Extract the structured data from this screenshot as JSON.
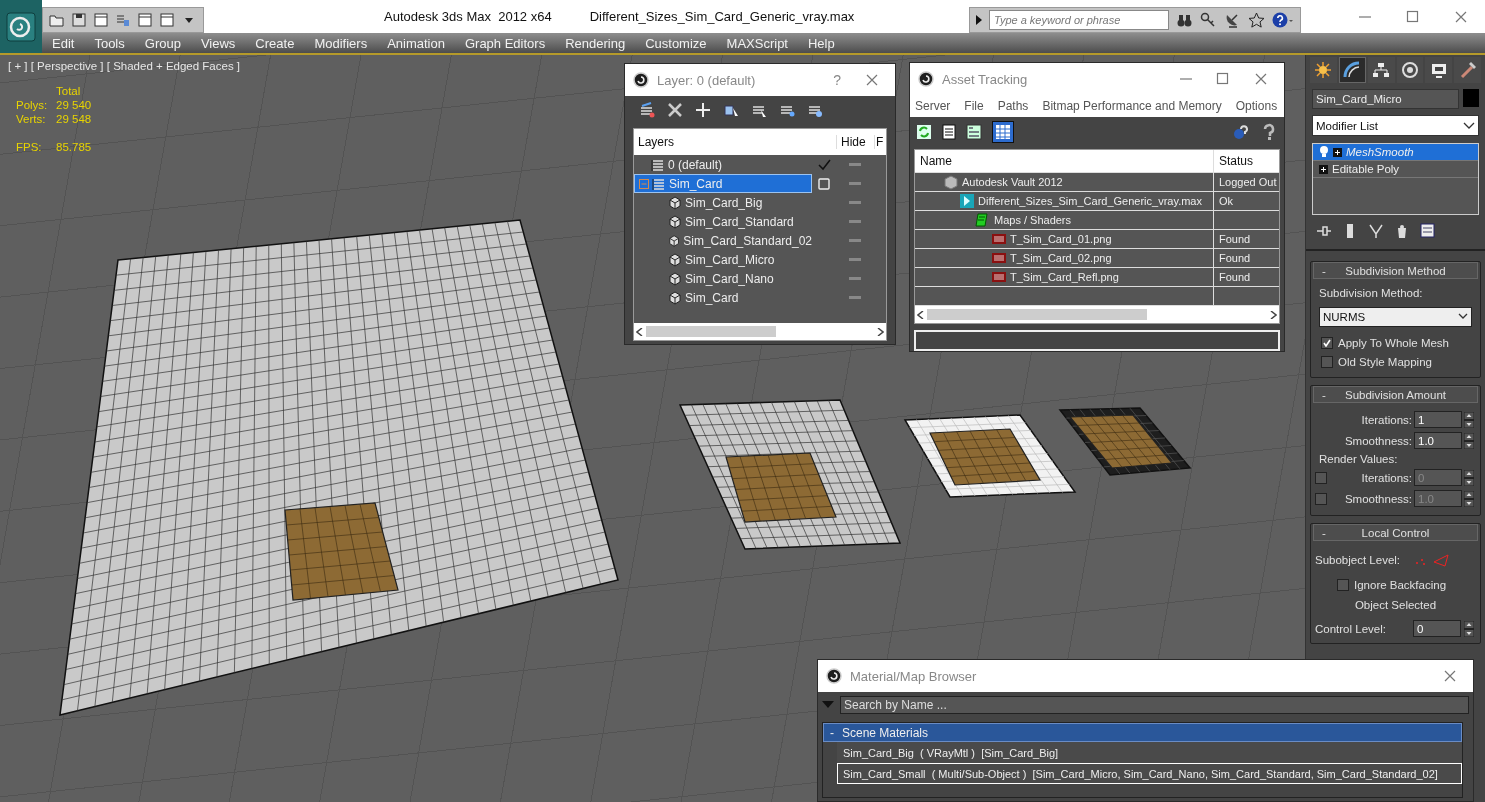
{
  "window": {
    "title": "Autodesk 3ds Max  2012 x64",
    "document": "Different_Sizes_Sim_Card_Generic_vray.max"
  },
  "search": {
    "placeholder": "Type a keyword or phrase"
  },
  "menu": [
    "Edit",
    "Tools",
    "Group",
    "Views",
    "Create",
    "Modifiers",
    "Animation",
    "Graph Editors",
    "Rendering",
    "Customize",
    "MAXScript",
    "Help"
  ],
  "viewport": {
    "label": "[ + ] [ Perspective ] [ Shaded + Edged Faces ]",
    "stats_header": "Total",
    "stats": [
      {
        "label": "Polys:",
        "value": "29 540"
      },
      {
        "label": "Verts:",
        "value": "29 548"
      }
    ],
    "fps_label": "FPS:",
    "fps": "85.785"
  },
  "layer_dialog": {
    "title": "Layer: 0 (default)",
    "help": "?",
    "columns": [
      "Layers",
      "Hide",
      "F"
    ],
    "layers": [
      {
        "name": "0 (default)",
        "current": true,
        "selected": false
      },
      {
        "name": "Sim_Card",
        "current": false,
        "selected": true,
        "expanded": true,
        "children": [
          {
            "name": "Sim_Card_Big"
          },
          {
            "name": "Sim_Card_Standard"
          },
          {
            "name": "Sim_Card_Standard_02"
          },
          {
            "name": "Sim_Card_Micro"
          },
          {
            "name": "Sim_Card_Nano"
          },
          {
            "name": "Sim_Card"
          }
        ]
      }
    ]
  },
  "asset_tracking": {
    "title": "Asset Tracking",
    "menu": [
      "Server",
      "File",
      "Paths",
      "Bitmap Performance and Memory",
      "Options"
    ],
    "columns": [
      "Name",
      "Status"
    ],
    "rows": [
      {
        "kind": "vault",
        "name": "Autodesk Vault 2012",
        "status": "Logged Out",
        "children": [
          {
            "kind": "scene",
            "name": "Different_Sizes_Sim_Card_Generic_vray.max",
            "status": "Ok",
            "children": [
              {
                "kind": "folder",
                "name": "Maps / Shaders",
                "children": [
                  {
                    "kind": "image",
                    "name": "T_Sim_Card_01.png",
                    "status": "Found"
                  },
                  {
                    "kind": "image",
                    "name": "T_Sim_Card_02.png",
                    "status": "Found"
                  },
                  {
                    "kind": "image",
                    "name": "T_Sim_Card_Refl.png",
                    "status": "Found"
                  }
                ]
              }
            ]
          }
        ]
      }
    ]
  },
  "command_panel": {
    "tabs": [
      {
        "kind": "create",
        "selected": false
      },
      {
        "kind": "modify",
        "selected": true
      },
      {
        "kind": "hierarchy",
        "selected": false
      },
      {
        "kind": "motion",
        "selected": false
      },
      {
        "kind": "display",
        "selected": false
      },
      {
        "kind": "utilities",
        "selected": false
      }
    ],
    "object_name": "Sim_Card_Micro",
    "modifier_list": "Modifier List",
    "stack": [
      {
        "kind": "modifier",
        "name": "MeshSmooth",
        "selected": true
      },
      {
        "kind": "base",
        "name": "Editable Poly",
        "selected": false
      }
    ],
    "subdivision_method": {
      "toggle": "-",
      "title": "Subdivision Method",
      "label": "Subdivision Method:",
      "method": "NURMS",
      "options": [
        {
          "label": "Apply To Whole Mesh",
          "checked": true
        },
        {
          "label": "Old Style Mapping",
          "checked": false
        }
      ]
    },
    "subdivision_amount": {
      "toggle": "-",
      "title": "Subdivision Amount",
      "spinners": [
        {
          "label": "Iterations:",
          "value": "1"
        },
        {
          "label": "Smoothness:",
          "value": "1.0"
        }
      ],
      "render_label": "Render Values:",
      "render_spinners": [
        {
          "label": "Iterations:",
          "value": "0",
          "checked": false
        },
        {
          "label": "Smoothness:",
          "value": "1.0",
          "checked": false
        }
      ]
    },
    "local_control": {
      "toggle": "-",
      "title": "Local Control",
      "subobject_label": "Subobject Level:",
      "ignore_backfacing": {
        "label": "Ignore Backfacing",
        "checked": false
      },
      "status": "Object Selected",
      "control_level": {
        "label": "Control Level:",
        "value": "0"
      }
    }
  },
  "material_browser": {
    "title": "Material/Map Browser",
    "search_placeholder": "Search by Name ...",
    "groups": [
      {
        "toggle": "-",
        "label": "Scene Materials",
        "expanded": true,
        "items": [
          {
            "text": "Sim_Card_Big  ( VRayMtl )  [Sim_Card_Big]",
            "selected": false
          },
          {
            "text": "Sim_Card_Small  ( Multi/Sub-Object )  [Sim_Card_Micro, Sim_Card_Nano, Sim_Card_Standard, Sim_Card_Standard_02]",
            "selected": true
          }
        ]
      }
    ]
  }
}
